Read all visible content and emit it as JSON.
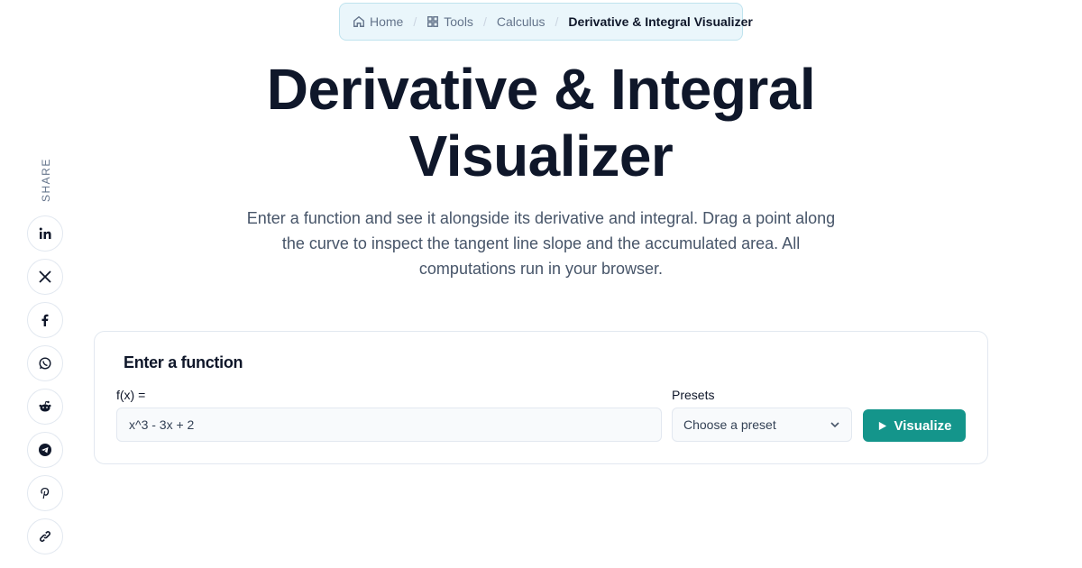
{
  "breadcrumb": {
    "home": "Home",
    "tools": "Tools",
    "calculus": "Calculus",
    "current": "Derivative & Integral Visualizer",
    "separator": "/"
  },
  "page": {
    "title_line1": "Derivative & Integral",
    "title_line2": "Visualizer",
    "description": "Enter a function and see it alongside its derivative and integral. Drag a point along the curve to inspect the tangent line slope and the accumulated area. All computations run in your browser."
  },
  "share": {
    "label": "SHARE",
    "icons": [
      "linkedin-icon",
      "x-icon",
      "facebook-icon",
      "whatsapp-icon",
      "reddit-icon",
      "telegram-icon",
      "pinterest-icon",
      "link-icon"
    ]
  },
  "form": {
    "title": "Enter a function",
    "function_label": "f(x) =",
    "function_value": "x^3 - 3x + 2",
    "presets_label": "Presets",
    "presets_selected": "Choose a preset",
    "button_label": "Visualize"
  },
  "colors": {
    "accent": "#14958b",
    "breadcrumb_bg": "#eaf6fb",
    "text": "#0f172a"
  }
}
